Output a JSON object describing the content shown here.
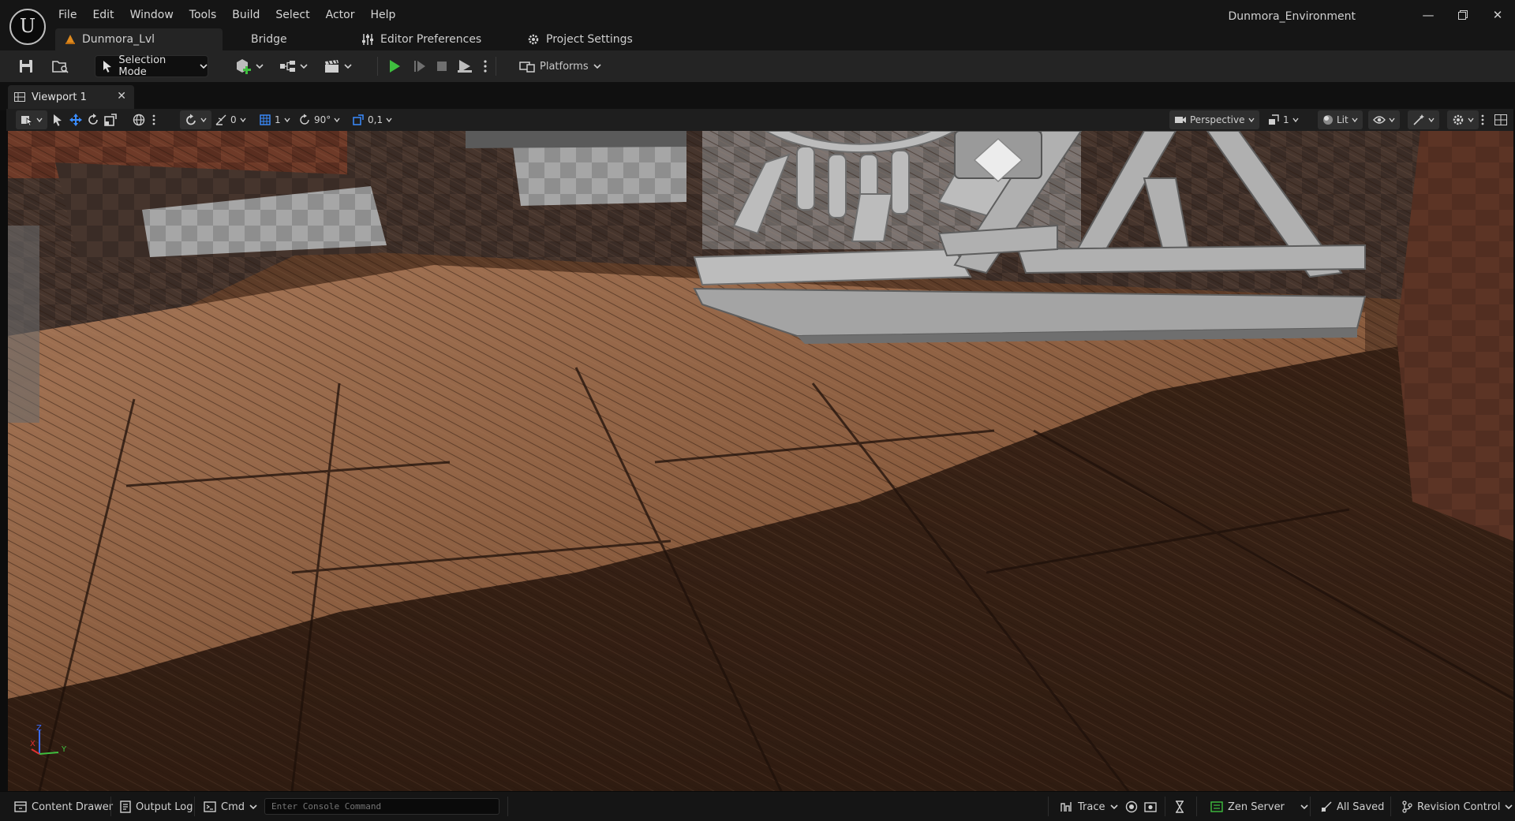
{
  "app": {
    "logo_text": "U",
    "project_name": "Dunmora_Environment"
  },
  "menu": [
    "File",
    "Edit",
    "Window",
    "Tools",
    "Build",
    "Select",
    "Actor",
    "Help"
  ],
  "tabs": {
    "level": "Dunmora_Lvl",
    "bridge": "Bridge",
    "editor_preferences": "Editor Preferences",
    "project_settings": "Project Settings"
  },
  "toolbar": {
    "selection_mode": "Selection Mode",
    "platforms": "Platforms"
  },
  "viewport": {
    "tab_label": "Viewport 1",
    "snap_rotation_count": "0",
    "grid_snap": "1",
    "rotation_snap": "90°",
    "scale_snap": "0,1",
    "view_mode": "Perspective",
    "camera_speed": "1",
    "lighting_mode": "Lit",
    "axis": {
      "x": "X",
      "y": "Y",
      "z": "Z"
    }
  },
  "statusbar": {
    "content_drawer": "Content Drawer",
    "output_log": "Output Log",
    "cmd": "Cmd",
    "console_placeholder": "Enter Console Command",
    "trace": "Trace",
    "zen_server": "Zen Server",
    "all_saved": "All Saved",
    "revision_control": "Revision Control"
  },
  "colors": {
    "play_green": "#3fbf3f",
    "accent_orange": "#e08a1e",
    "selection_blue": "#3a8cff"
  }
}
